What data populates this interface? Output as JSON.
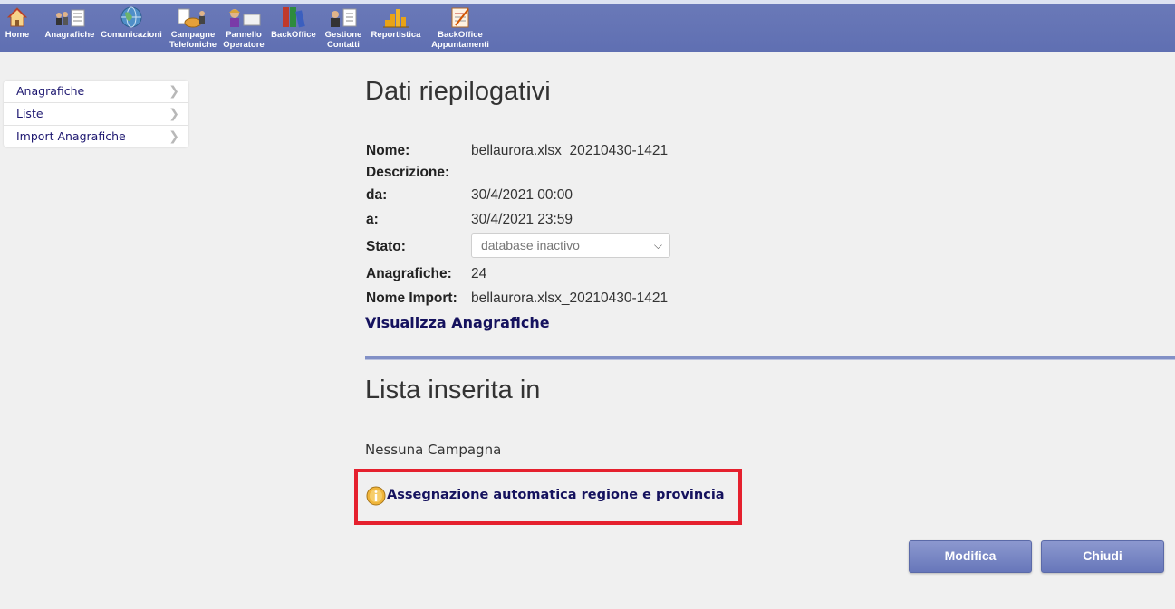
{
  "nav": [
    {
      "label": "Home",
      "icon": "home-icon"
    },
    {
      "label": "Anagrafiche",
      "icon": "people-list-icon"
    },
    {
      "label": "Comunicazioni",
      "icon": "globe-icon"
    },
    {
      "label": "Campagne Telefoniche",
      "icon": "phone-campaign-icon"
    },
    {
      "label": "Pannello Operatore",
      "icon": "operator-panel-icon"
    },
    {
      "label": "BackOffice",
      "icon": "binders-icon"
    },
    {
      "label": "Gestione Contatti",
      "icon": "contacts-icon"
    },
    {
      "label": "Reportistica",
      "icon": "bar-chart-icon"
    },
    {
      "label": "BackOffice Appuntamenti",
      "icon": "appointments-icon"
    }
  ],
  "sidebar": {
    "items": [
      {
        "label": "Anagrafiche"
      },
      {
        "label": "Liste"
      },
      {
        "label": "Import Anagrafiche"
      }
    ]
  },
  "summary": {
    "title": "Dati riepilogativi",
    "nome_label": "Nome:",
    "nome_value": "bellaurora.xlsx_20210430-1421",
    "descrizione_label": "Descrizione:",
    "descrizione_value": "",
    "da_label": "da:",
    "da_value": "30/4/2021 00:00",
    "a_label": "a:",
    "a_value": "30/4/2021 23:59",
    "stato_label": "Stato:",
    "stato_value": "database inactivo",
    "anagrafiche_label": "Anagrafiche:",
    "anagrafiche_value": "24",
    "nome_import_label": "Nome Import:",
    "nome_import_value": "bellaurora.xlsx_20210430-1421",
    "visualizza_link": "Visualizza Anagrafiche"
  },
  "lista": {
    "title": "Lista inserita in",
    "nessuna": "Nessuna Campagna",
    "assegnazione_link": "Assegnazione automatica regione e provincia"
  },
  "buttons": {
    "modifica": "Modifica",
    "chiudi": "Chiudi"
  },
  "colors": {
    "nav_bar": "#5f6fb2",
    "link": "#15125e",
    "highlight": "#e5202e",
    "button": "#6777ba"
  }
}
